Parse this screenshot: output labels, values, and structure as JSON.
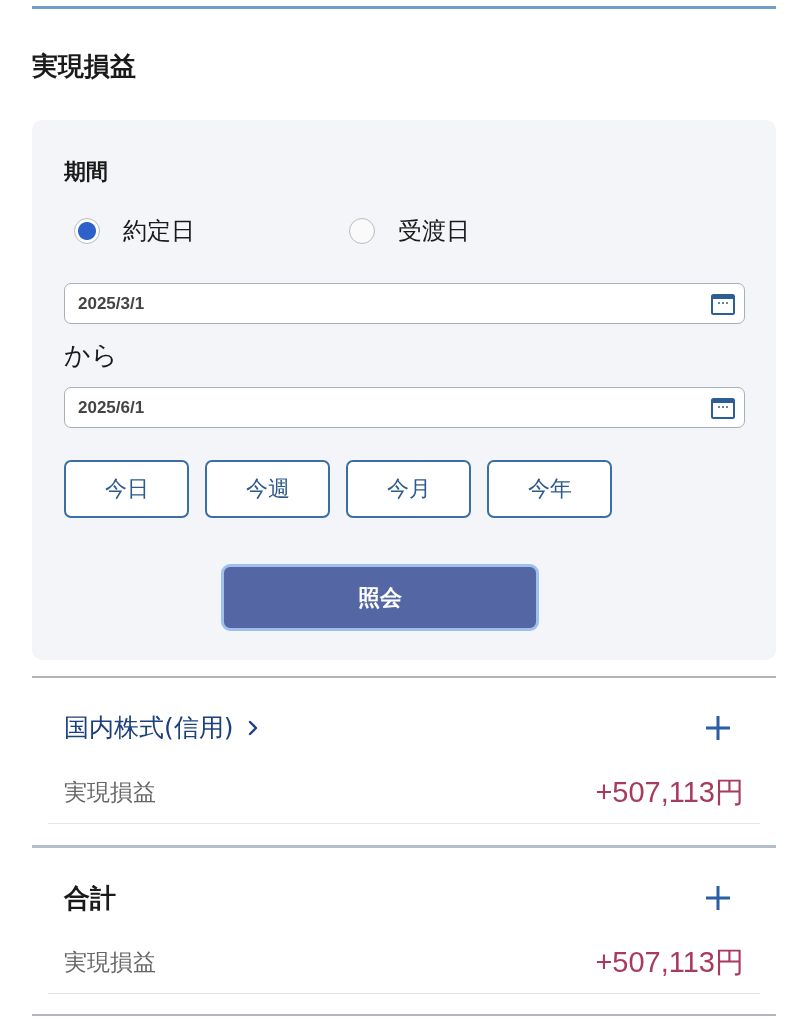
{
  "section_title": "実現損益",
  "filter": {
    "label": "期間",
    "date_basis": [
      {
        "label": "約定日",
        "selected": true
      },
      {
        "label": "受渡日",
        "selected": false
      }
    ],
    "from_date": {
      "value": "2025/3/1"
    },
    "separator": "から",
    "to_date": {
      "value": "2025/6/1"
    },
    "quick_ranges": [
      "今日",
      "今週",
      "今月",
      "今年"
    ],
    "submit": "照会"
  },
  "groups": [
    {
      "kind": "link",
      "title": "国内株式(信用)",
      "expanded": false,
      "rows": [
        {
          "label": "実現損益",
          "value": "+507,113円"
        }
      ]
    },
    {
      "kind": "total",
      "title": "合計",
      "expanded": false,
      "rows": [
        {
          "label": "実現損益",
          "value": "+507,113円"
        }
      ]
    }
  ]
}
